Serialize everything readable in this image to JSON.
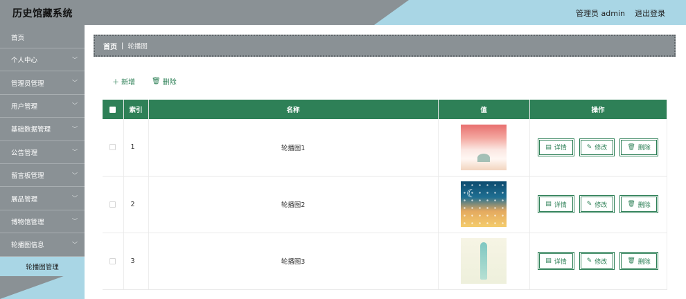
{
  "header": {
    "title": "历史馆藏系统",
    "user_label": "管理员 admin",
    "logout_label": "退出登录"
  },
  "sidebar": {
    "items": [
      {
        "label": "首页",
        "has_chevron": false
      },
      {
        "label": "个人中心",
        "has_chevron": true
      },
      {
        "label": "管理员管理",
        "has_chevron": true
      },
      {
        "label": "用户管理",
        "has_chevron": true
      },
      {
        "label": "基础数据管理",
        "has_chevron": true
      },
      {
        "label": "公告管理",
        "has_chevron": true
      },
      {
        "label": "留言板管理",
        "has_chevron": true
      },
      {
        "label": "展品管理",
        "has_chevron": true
      },
      {
        "label": "博物馆管理",
        "has_chevron": true
      },
      {
        "label": "轮播图信息",
        "has_chevron": true
      }
    ],
    "sub_item": "轮播图管理"
  },
  "breadcrumb": {
    "home": "首页",
    "separator": "|",
    "current": "轮播图"
  },
  "toolbar": {
    "add_label": "新增",
    "delete_label": "删除"
  },
  "table": {
    "headers": {
      "index": "索引",
      "name": "名称",
      "value": "值",
      "ops": "操作"
    },
    "rows": [
      {
        "index": "1",
        "name": "轮播图1",
        "thumb": "pink-sunset-silhouette"
      },
      {
        "index": "2",
        "name": "轮播图2",
        "thumb": "night-moon-sky"
      },
      {
        "index": "3",
        "name": "轮播图3",
        "thumb": "pale-bottle-illustration"
      }
    ],
    "op_labels": {
      "detail": "详情",
      "edit": "修改",
      "delete": "删除"
    }
  },
  "colors": {
    "primary": "#2e8057",
    "sidebar": "#8a9195",
    "accent": "#a9d6e5"
  }
}
